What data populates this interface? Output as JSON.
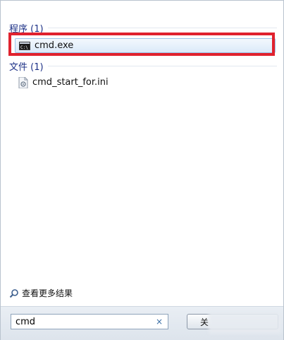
{
  "groups": {
    "programs": {
      "label": "程序 (1)"
    },
    "files": {
      "label": "文件 (1)"
    }
  },
  "results": {
    "program_item": {
      "label": "cmd.exe",
      "icon": "console-icon"
    },
    "file_item": {
      "label": "cmd_start_for.ini",
      "icon": "ini-file-icon"
    }
  },
  "see_more": {
    "label": "查看更多结果",
    "icon": "search-icon"
  },
  "search": {
    "value": "cmd",
    "clear_label": "×"
  },
  "shutdown": {
    "label": "关"
  },
  "colors": {
    "highlight": "#e0222e",
    "header": "#1e3287"
  }
}
